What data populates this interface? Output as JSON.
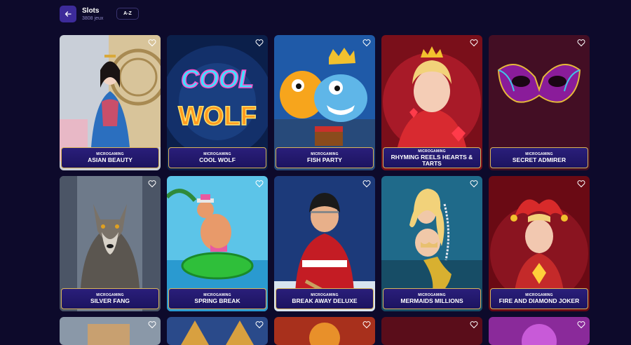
{
  "header": {
    "title": "Slots",
    "subtitle": "3808 jeux",
    "sort_label": "A-Z"
  },
  "games": [
    {
      "provider": "MICROGAMING",
      "name": "ASIAN BEAUTY"
    },
    {
      "provider": "MICROGAMING",
      "name": "COOL WOLF"
    },
    {
      "provider": "MICROGAMING",
      "name": "FISH PARTY"
    },
    {
      "provider": "MICROGAMING",
      "name": "RHYMING REELS HEARTS & TARTS"
    },
    {
      "provider": "MICROGAMING",
      "name": "SECRET ADMIRER"
    },
    {
      "provider": "MICROGAMING",
      "name": "SILVER FANG"
    },
    {
      "provider": "MICROGAMING",
      "name": "SPRING BREAK"
    },
    {
      "provider": "MICROGAMING",
      "name": "BREAK AWAY DELUXE"
    },
    {
      "provider": "MICROGAMING",
      "name": "MERMAIDS MILLIONS"
    },
    {
      "provider": "MICROGAMING",
      "name": "FIRE AND DIAMOND JOKER"
    }
  ],
  "art_titles": {
    "cool_wolf_line1": "COOL",
    "cool_wolf_line2": "WOLF"
  },
  "colors": {
    "background": "#0d0a2b",
    "accent": "#3d2b9a",
    "label_border": "#d8b45a"
  }
}
